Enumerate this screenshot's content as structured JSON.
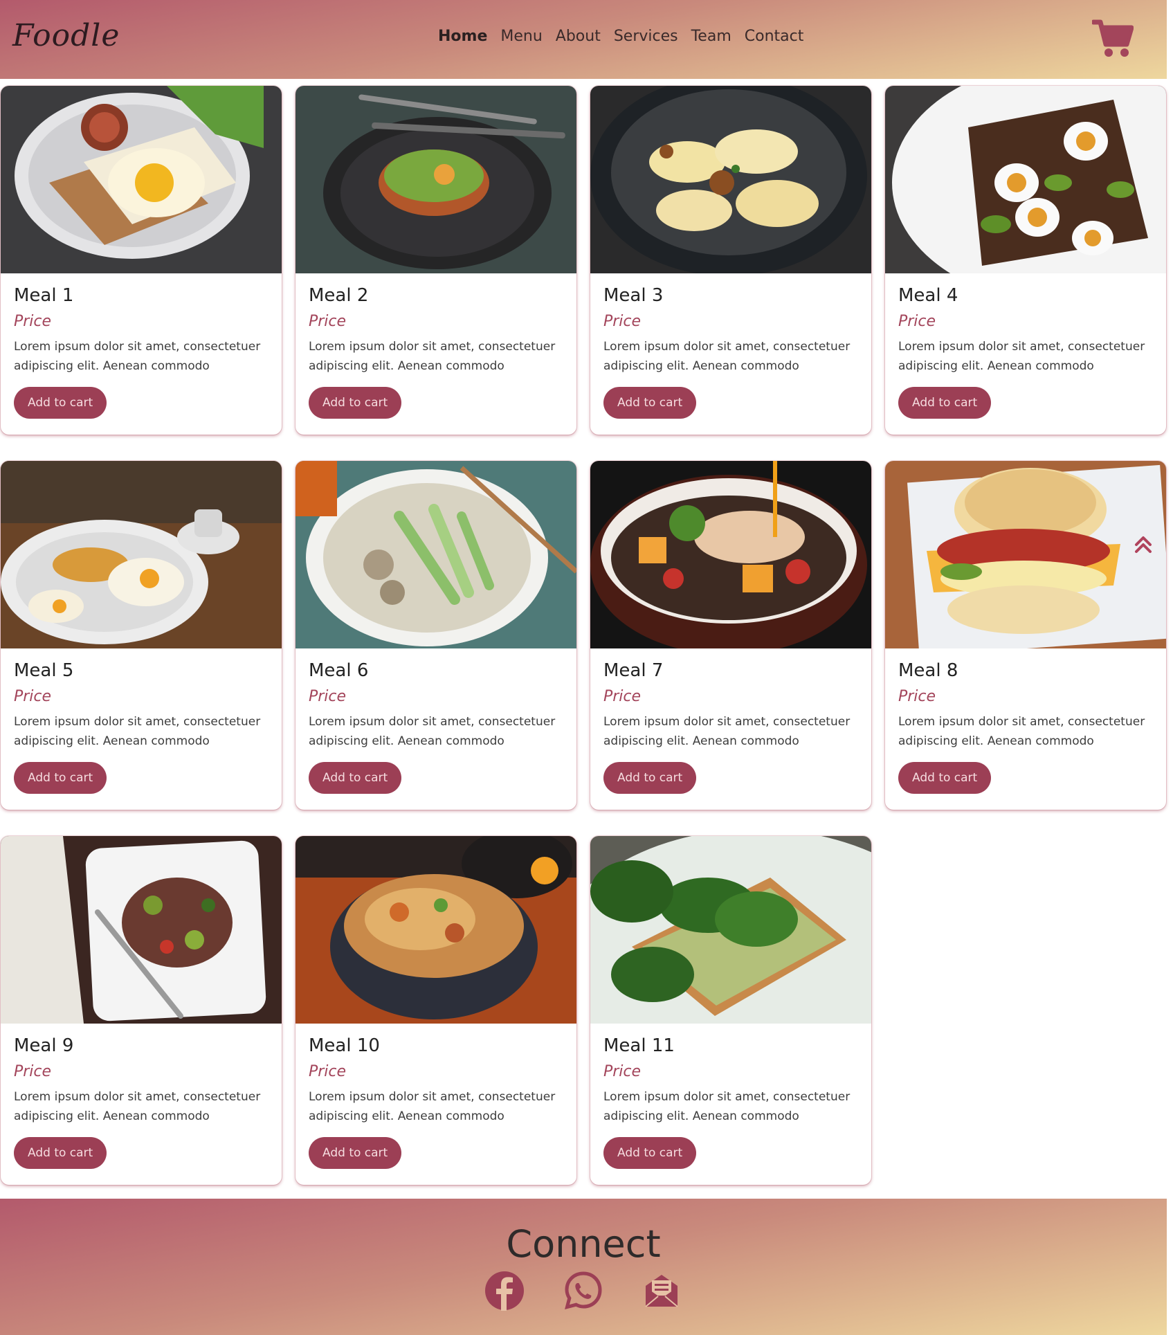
{
  "brand": {
    "logo_text": "Foodle"
  },
  "nav": {
    "links": [
      {
        "label": "Home",
        "active": true
      },
      {
        "label": "Menu",
        "active": false
      },
      {
        "label": "About",
        "active": false
      },
      {
        "label": "Services",
        "active": false
      },
      {
        "label": "Team",
        "active": false
      },
      {
        "label": "Contact",
        "active": false
      }
    ],
    "cart_icon": "shopping-cart-icon"
  },
  "meals": [
    {
      "title": "Meal 1",
      "price": "Price",
      "description": "Lorem ipsum dolor sit amet, consectetuer adipiscing elit. Aenean commodo",
      "button": "Add to cart",
      "image": "eggs-on-toast"
    },
    {
      "title": "Meal 2",
      "price": "Price",
      "description": "Lorem ipsum dolor sit amet, consectetuer adipiscing elit. Aenean commodo",
      "button": "Add to cart",
      "image": "avocado-toast-dark-plate"
    },
    {
      "title": "Meal 3",
      "price": "Price",
      "description": "Lorem ipsum dolor sit amet, consectetuer adipiscing elit. Aenean commodo",
      "button": "Add to cart",
      "image": "dumplings-bowl"
    },
    {
      "title": "Meal 4",
      "price": "Price",
      "description": "Lorem ipsum dolor sit amet, consectetuer adipiscing elit. Aenean commodo",
      "button": "Add to cart",
      "image": "egg-avocado-toast"
    },
    {
      "title": "Meal 5",
      "price": "Price",
      "description": "Lorem ipsum dolor sit amet, consectetuer adipiscing elit. Aenean commodo",
      "button": "Add to cart",
      "image": "breakfast-plate"
    },
    {
      "title": "Meal 6",
      "price": "Price",
      "description": "Lorem ipsum dolor sit amet, consectetuer adipiscing elit. Aenean commodo",
      "button": "Add to cart",
      "image": "noodle-soup"
    },
    {
      "title": "Meal 7",
      "price": "Price",
      "description": "Lorem ipsum dolor sit amet, consectetuer adipiscing elit. Aenean commodo",
      "button": "Add to cart",
      "image": "chicken-quinoa-bowl"
    },
    {
      "title": "Meal 8",
      "price": "Price",
      "description": "Lorem ipsum dolor sit amet, consectetuer adipiscing elit. Aenean commodo",
      "button": "Add to cart",
      "image": "biscuit-sandwich"
    },
    {
      "title": "Meal 9",
      "price": "Price",
      "description": "Lorem ipsum dolor sit amet, consectetuer adipiscing elit. Aenean commodo",
      "button": "Add to cart",
      "image": "steak-salad"
    },
    {
      "title": "Meal 10",
      "price": "Price",
      "description": "Lorem ipsum dolor sit amet, consectetuer adipiscing elit. Aenean commodo",
      "button": "Add to cart",
      "image": "stir-fry-noodles"
    },
    {
      "title": "Meal 11",
      "price": "Price",
      "description": "Lorem ipsum dolor sit amet, consectetuer adipiscing elit. Aenean commodo",
      "button": "Add to cart",
      "image": "spinach-toast"
    }
  ],
  "scroll_top_icon": "chevrons-up-icon",
  "footer": {
    "title": "Connect",
    "social": [
      "facebook-icon",
      "whatsapp-icon",
      "envelope-open-icon"
    ]
  },
  "colors": {
    "accent": "#9c3f55",
    "price": "#a3455b",
    "gradient_start": "#b35a6c",
    "gradient_end": "#eed79e"
  }
}
